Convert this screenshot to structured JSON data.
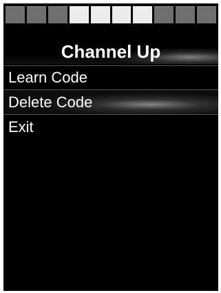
{
  "segments": [
    {
      "active": false
    },
    {
      "active": false
    },
    {
      "active": false
    },
    {
      "active": true
    },
    {
      "active": true
    },
    {
      "active": true
    },
    {
      "active": true
    },
    {
      "active": false
    },
    {
      "active": false
    },
    {
      "active": false
    }
  ],
  "colors": {
    "background": "#000000",
    "text": "#ffffff",
    "segment_inactive": "#6f6f6f",
    "segment_active": "#ececec"
  },
  "header": {
    "title": "Channel Up"
  },
  "menu": {
    "items": [
      {
        "label": "Learn Code",
        "selected": false
      },
      {
        "label": "Delete Code",
        "selected": true
      },
      {
        "label": "Exit",
        "selected": false
      }
    ]
  }
}
